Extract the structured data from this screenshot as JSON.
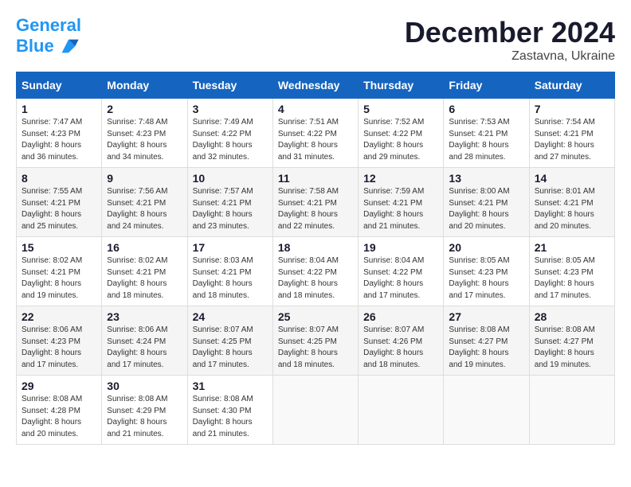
{
  "header": {
    "logo_line1": "General",
    "logo_line2": "Blue",
    "month": "December 2024",
    "location": "Zastavna, Ukraine"
  },
  "weekdays": [
    "Sunday",
    "Monday",
    "Tuesday",
    "Wednesday",
    "Thursday",
    "Friday",
    "Saturday"
  ],
  "weeks": [
    [
      {
        "day": "1",
        "sunrise": "7:47 AM",
        "sunset": "4:23 PM",
        "daylight": "8 hours and 36 minutes."
      },
      {
        "day": "2",
        "sunrise": "7:48 AM",
        "sunset": "4:23 PM",
        "daylight": "8 hours and 34 minutes."
      },
      {
        "day": "3",
        "sunrise": "7:49 AM",
        "sunset": "4:22 PM",
        "daylight": "8 hours and 32 minutes."
      },
      {
        "day": "4",
        "sunrise": "7:51 AM",
        "sunset": "4:22 PM",
        "daylight": "8 hours and 31 minutes."
      },
      {
        "day": "5",
        "sunrise": "7:52 AM",
        "sunset": "4:22 PM",
        "daylight": "8 hours and 29 minutes."
      },
      {
        "day": "6",
        "sunrise": "7:53 AM",
        "sunset": "4:21 PM",
        "daylight": "8 hours and 28 minutes."
      },
      {
        "day": "7",
        "sunrise": "7:54 AM",
        "sunset": "4:21 PM",
        "daylight": "8 hours and 27 minutes."
      }
    ],
    [
      {
        "day": "8",
        "sunrise": "7:55 AM",
        "sunset": "4:21 PM",
        "daylight": "8 hours and 25 minutes."
      },
      {
        "day": "9",
        "sunrise": "7:56 AM",
        "sunset": "4:21 PM",
        "daylight": "8 hours and 24 minutes."
      },
      {
        "day": "10",
        "sunrise": "7:57 AM",
        "sunset": "4:21 PM",
        "daylight": "8 hours and 23 minutes."
      },
      {
        "day": "11",
        "sunrise": "7:58 AM",
        "sunset": "4:21 PM",
        "daylight": "8 hours and 22 minutes."
      },
      {
        "day": "12",
        "sunrise": "7:59 AM",
        "sunset": "4:21 PM",
        "daylight": "8 hours and 21 minutes."
      },
      {
        "day": "13",
        "sunrise": "8:00 AM",
        "sunset": "4:21 PM",
        "daylight": "8 hours and 20 minutes."
      },
      {
        "day": "14",
        "sunrise": "8:01 AM",
        "sunset": "4:21 PM",
        "daylight": "8 hours and 20 minutes."
      }
    ],
    [
      {
        "day": "15",
        "sunrise": "8:02 AM",
        "sunset": "4:21 PM",
        "daylight": "8 hours and 19 minutes."
      },
      {
        "day": "16",
        "sunrise": "8:02 AM",
        "sunset": "4:21 PM",
        "daylight": "8 hours and 18 minutes."
      },
      {
        "day": "17",
        "sunrise": "8:03 AM",
        "sunset": "4:21 PM",
        "daylight": "8 hours and 18 minutes."
      },
      {
        "day": "18",
        "sunrise": "8:04 AM",
        "sunset": "4:22 PM",
        "daylight": "8 hours and 18 minutes."
      },
      {
        "day": "19",
        "sunrise": "8:04 AM",
        "sunset": "4:22 PM",
        "daylight": "8 hours and 17 minutes."
      },
      {
        "day": "20",
        "sunrise": "8:05 AM",
        "sunset": "4:23 PM",
        "daylight": "8 hours and 17 minutes."
      },
      {
        "day": "21",
        "sunrise": "8:05 AM",
        "sunset": "4:23 PM",
        "daylight": "8 hours and 17 minutes."
      }
    ],
    [
      {
        "day": "22",
        "sunrise": "8:06 AM",
        "sunset": "4:23 PM",
        "daylight": "8 hours and 17 minutes."
      },
      {
        "day": "23",
        "sunrise": "8:06 AM",
        "sunset": "4:24 PM",
        "daylight": "8 hours and 17 minutes."
      },
      {
        "day": "24",
        "sunrise": "8:07 AM",
        "sunset": "4:25 PM",
        "daylight": "8 hours and 17 minutes."
      },
      {
        "day": "25",
        "sunrise": "8:07 AM",
        "sunset": "4:25 PM",
        "daylight": "8 hours and 18 minutes."
      },
      {
        "day": "26",
        "sunrise": "8:07 AM",
        "sunset": "4:26 PM",
        "daylight": "8 hours and 18 minutes."
      },
      {
        "day": "27",
        "sunrise": "8:08 AM",
        "sunset": "4:27 PM",
        "daylight": "8 hours and 19 minutes."
      },
      {
        "day": "28",
        "sunrise": "8:08 AM",
        "sunset": "4:27 PM",
        "daylight": "8 hours and 19 minutes."
      }
    ],
    [
      {
        "day": "29",
        "sunrise": "8:08 AM",
        "sunset": "4:28 PM",
        "daylight": "8 hours and 20 minutes."
      },
      {
        "day": "30",
        "sunrise": "8:08 AM",
        "sunset": "4:29 PM",
        "daylight": "8 hours and 21 minutes."
      },
      {
        "day": "31",
        "sunrise": "8:08 AM",
        "sunset": "4:30 PM",
        "daylight": "8 hours and 21 minutes."
      },
      null,
      null,
      null,
      null
    ]
  ]
}
